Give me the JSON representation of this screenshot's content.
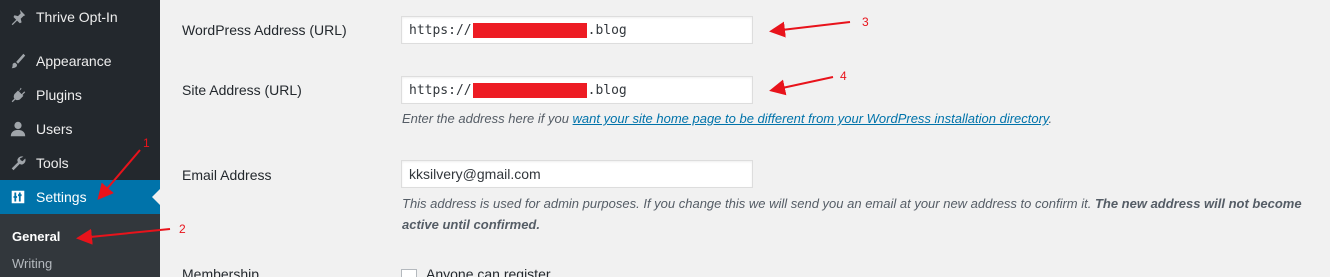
{
  "sidebar": {
    "items": [
      {
        "label": "Thrive Opt-In",
        "icon": "pin-icon"
      },
      {
        "label": "Appearance",
        "icon": "brush-icon"
      },
      {
        "label": "Plugins",
        "icon": "plug-icon"
      },
      {
        "label": "Users",
        "icon": "user-icon"
      },
      {
        "label": "Tools",
        "icon": "wrench-icon"
      },
      {
        "label": "Settings",
        "icon": "settings-icon",
        "current": true
      }
    ],
    "submenu": [
      {
        "label": "General",
        "current": true
      },
      {
        "label": "Writing"
      }
    ]
  },
  "form": {
    "wordpress_address": {
      "label": "WordPress Address (URL)",
      "prefix": "https://",
      "suffix": ".blog"
    },
    "site_address": {
      "label": "Site Address (URL)",
      "prefix": "https://",
      "suffix": ".blog",
      "desc_before": "Enter the address here if you ",
      "desc_link": "want your site home page to be different from your WordPress installation directory",
      "desc_after": "."
    },
    "email": {
      "label": "Email Address",
      "value": "kksilvery@gmail.com",
      "desc": "This address is used for admin purposes. If you change this we will send you an email at your new address to confirm it. ",
      "desc_bold": "The new address will not become active until confirmed."
    },
    "membership": {
      "label": "Membership",
      "checkbox_label": "Anyone can register"
    }
  },
  "annotations": [
    "1",
    "2",
    "3",
    "4"
  ],
  "colors": {
    "accent": "#0073aa",
    "sidebar_bg": "#23282d",
    "annotation": "#e8131b"
  }
}
